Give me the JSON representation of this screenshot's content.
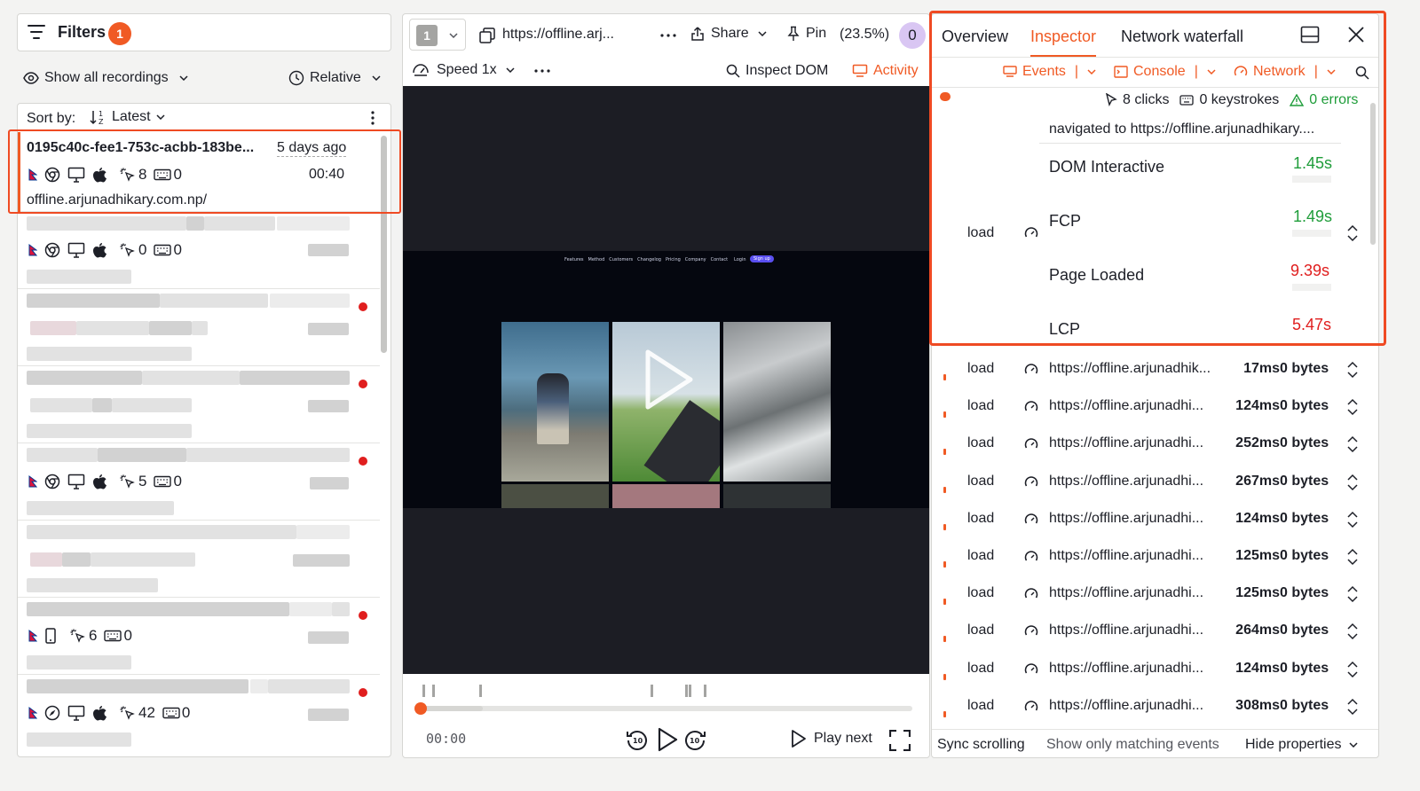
{
  "left": {
    "filters_label": "Filters",
    "filters_count": "1",
    "show_all": "Show all recordings",
    "relative": "Relative",
    "sort_by": "Sort by:",
    "sort_value": "Latest",
    "selected": {
      "id": "0195c40c-fee1-753c-acbb-183be...",
      "age": "5 days ago",
      "clicks": "8",
      "keys": "0",
      "duration": "00:40",
      "url": "offline.arjunadhikary.com.np/"
    },
    "items": [
      {
        "clicks": "0",
        "keys": "0"
      },
      {
        "clicks": "5",
        "keys": "0"
      },
      {
        "clicks": "6",
        "keys": "0"
      },
      {
        "clicks": "42",
        "keys": "0"
      }
    ]
  },
  "player": {
    "tab_num": "1",
    "url": "https://offline.arj...",
    "share": "Share",
    "pin": "Pin",
    "percent": "(23.5%)",
    "count": "0",
    "speed": "Speed 1x",
    "inspect": "Inspect DOM",
    "activity": "Activity",
    "time": "00:00",
    "play_next": "Play next",
    "site_nav": [
      "Features",
      "Method",
      "Customers",
      "Changelog",
      "Pricing",
      "Company",
      "Contact"
    ],
    "site_login": "Login",
    "site_signup": "Sign up",
    "progress": 0.0
  },
  "right": {
    "tabs": [
      "Overview",
      "Inspector",
      "Network waterfall"
    ],
    "filters": [
      "Events",
      "Console",
      "Network"
    ],
    "stats": {
      "clicks": "8 clicks",
      "keys": "0 keystrokes",
      "errors": "0 errors"
    },
    "navigated": "navigated to https://offline.arjunadhikary....",
    "load_label": "load",
    "metrics": [
      {
        "name": "DOM Interactive",
        "value": "1.45s",
        "status": "good"
      },
      {
        "name": "FCP",
        "value": "1.49s",
        "status": "good"
      },
      {
        "name": "Page Loaded",
        "value": "9.39s",
        "status": "bad"
      },
      {
        "name": "LCP",
        "value": "5.47s",
        "status": "bad"
      }
    ],
    "network": [
      {
        "type": "load",
        "url": "https://offline.arjunadhik...",
        "time": "17ms",
        "size": "0 bytes"
      },
      {
        "type": "load",
        "url": "https://offline.arjunadhi...",
        "time": "124ms",
        "size": "0 bytes"
      },
      {
        "type": "load",
        "url": "https://offline.arjunadhi...",
        "time": "252ms",
        "size": "0 bytes"
      },
      {
        "type": "load",
        "url": "https://offline.arjunadhi...",
        "time": "267ms",
        "size": "0 bytes"
      },
      {
        "type": "load",
        "url": "https://offline.arjunadhi...",
        "time": "124ms",
        "size": "0 bytes"
      },
      {
        "type": "load",
        "url": "https://offline.arjunadhi...",
        "time": "125ms",
        "size": "0 bytes"
      },
      {
        "type": "load",
        "url": "https://offline.arjunadhi...",
        "time": "125ms",
        "size": "0 bytes"
      },
      {
        "type": "load",
        "url": "https://offline.arjunadhi...",
        "time": "264ms",
        "size": "0 bytes"
      },
      {
        "type": "load",
        "url": "https://offline.arjunadhi...",
        "time": "124ms",
        "size": "0 bytes"
      },
      {
        "type": "load",
        "url": "https://offline.arjunadhi...",
        "time": "308ms",
        "size": "0 bytes"
      }
    ],
    "bottom": {
      "sync": "Sync scrolling",
      "matching": "Show only matching events",
      "hide": "Hide properties"
    }
  },
  "colors": {
    "accent": "#f05a24",
    "good": "#1f9d3a",
    "bad": "#e01e1e",
    "highlight": "#ef4a23"
  }
}
